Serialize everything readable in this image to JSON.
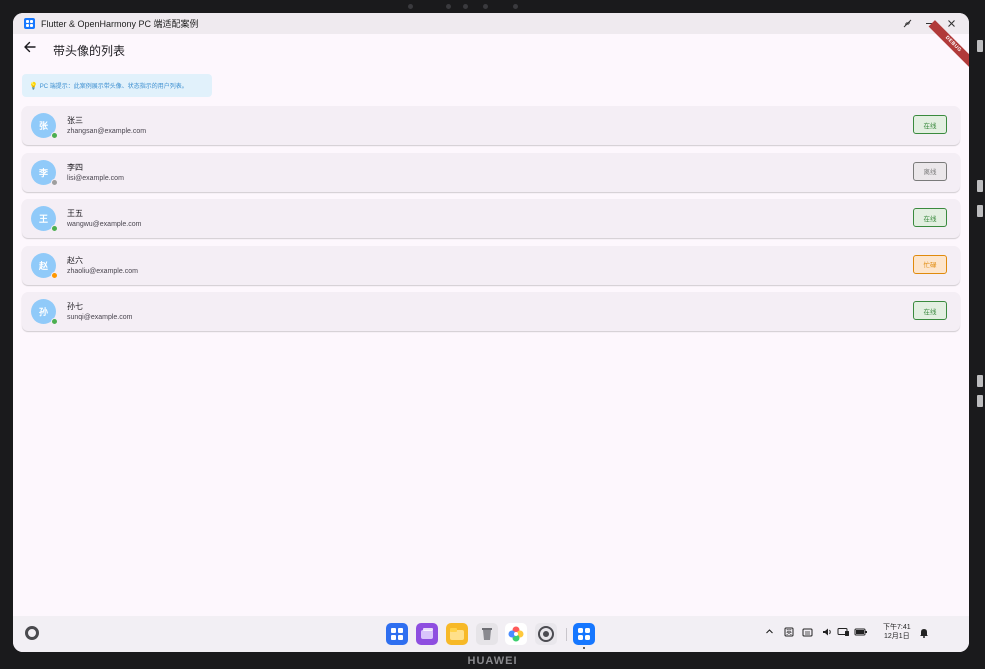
{
  "window": {
    "title": "Flutter & OpenHarmony PC 端适配案例",
    "controls": [
      "minimize-icon",
      "maximize-icon",
      "close-icon"
    ]
  },
  "appbar": {
    "back_icon": "arrow-left-icon",
    "title": "带头像的列表",
    "debug_banner": "DEBUG"
  },
  "hint": {
    "icon": "lightbulb-icon",
    "text": "PC 端提示：此案例展示带头像、状态指示的用户列表。"
  },
  "users": [
    {
      "initial": "张",
      "name": "张三",
      "email": "zhangsan@example.com",
      "status": "在线",
      "status_color": "#4caf50",
      "status_bg": "#e3efe1",
      "status_text_color": "#3a8a3e"
    },
    {
      "initial": "李",
      "name": "李四",
      "email": "lisi@example.com",
      "status": "离线",
      "status_color": "#9e9e9e",
      "status_bg": "#ebe7ea",
      "status_text_color": "#7a7a7a"
    },
    {
      "initial": "王",
      "name": "王五",
      "email": "wangwu@example.com",
      "status": "在线",
      "status_color": "#4caf50",
      "status_bg": "#e3efe1",
      "status_text_color": "#3a8a3e"
    },
    {
      "initial": "赵",
      "name": "赵六",
      "email": "zhaoliu@example.com",
      "status": "忙碌",
      "status_color": "#ff9800",
      "status_bg": "#fde5cc",
      "status_text_color": "#e08a0c"
    },
    {
      "initial": "孙",
      "name": "孙七",
      "email": "sunqi@example.com",
      "status": "在线",
      "status_color": "#4caf50",
      "status_bg": "#e3efe1",
      "status_text_color": "#3a8a3e"
    }
  ],
  "colors": {
    "avatar_bg": "#90caf9",
    "page_bg": "#fdf7fd",
    "card_bg": "#f4eef5"
  },
  "taskbar": {
    "dock_apps": [
      "app-grid-icon",
      "multi-window-icon",
      "files-icon",
      "trash-icon",
      "photos-icon",
      "settings-icon",
      "flutter-app-icon"
    ],
    "tray_icons": [
      "chevron-up-icon",
      "input-method-icon",
      "keyboard-icon",
      "volume-icon",
      "display-icon",
      "battery-icon",
      "notification-bell-icon"
    ],
    "time": "下午7:41",
    "date": "12月1日"
  },
  "device": {
    "brand": "HUAWEI"
  }
}
